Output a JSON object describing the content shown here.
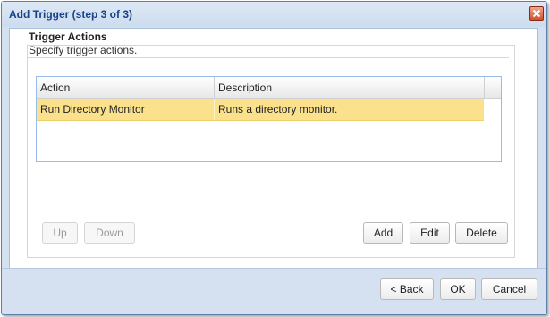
{
  "window": {
    "title": "Add Trigger (step 3 of 3)",
    "close_icon": "close-icon"
  },
  "section": {
    "title": "Trigger Actions",
    "subtitle": "Specify trigger actions."
  },
  "grid": {
    "columns": [
      "Action",
      "Description"
    ],
    "rows": [
      {
        "action": "Run Directory Monitor",
        "description": "Runs a directory monitor.",
        "selected": true
      }
    ]
  },
  "row_buttons": {
    "up": "Up",
    "down": "Down",
    "add": "Add",
    "edit": "Edit",
    "delete": "Delete"
  },
  "footer": {
    "back": "< Back",
    "ok": "OK",
    "cancel": "Cancel"
  },
  "colors": {
    "title_text": "#15428b",
    "selected_row": "#fbe18c",
    "frame": "#d5e1f0"
  }
}
